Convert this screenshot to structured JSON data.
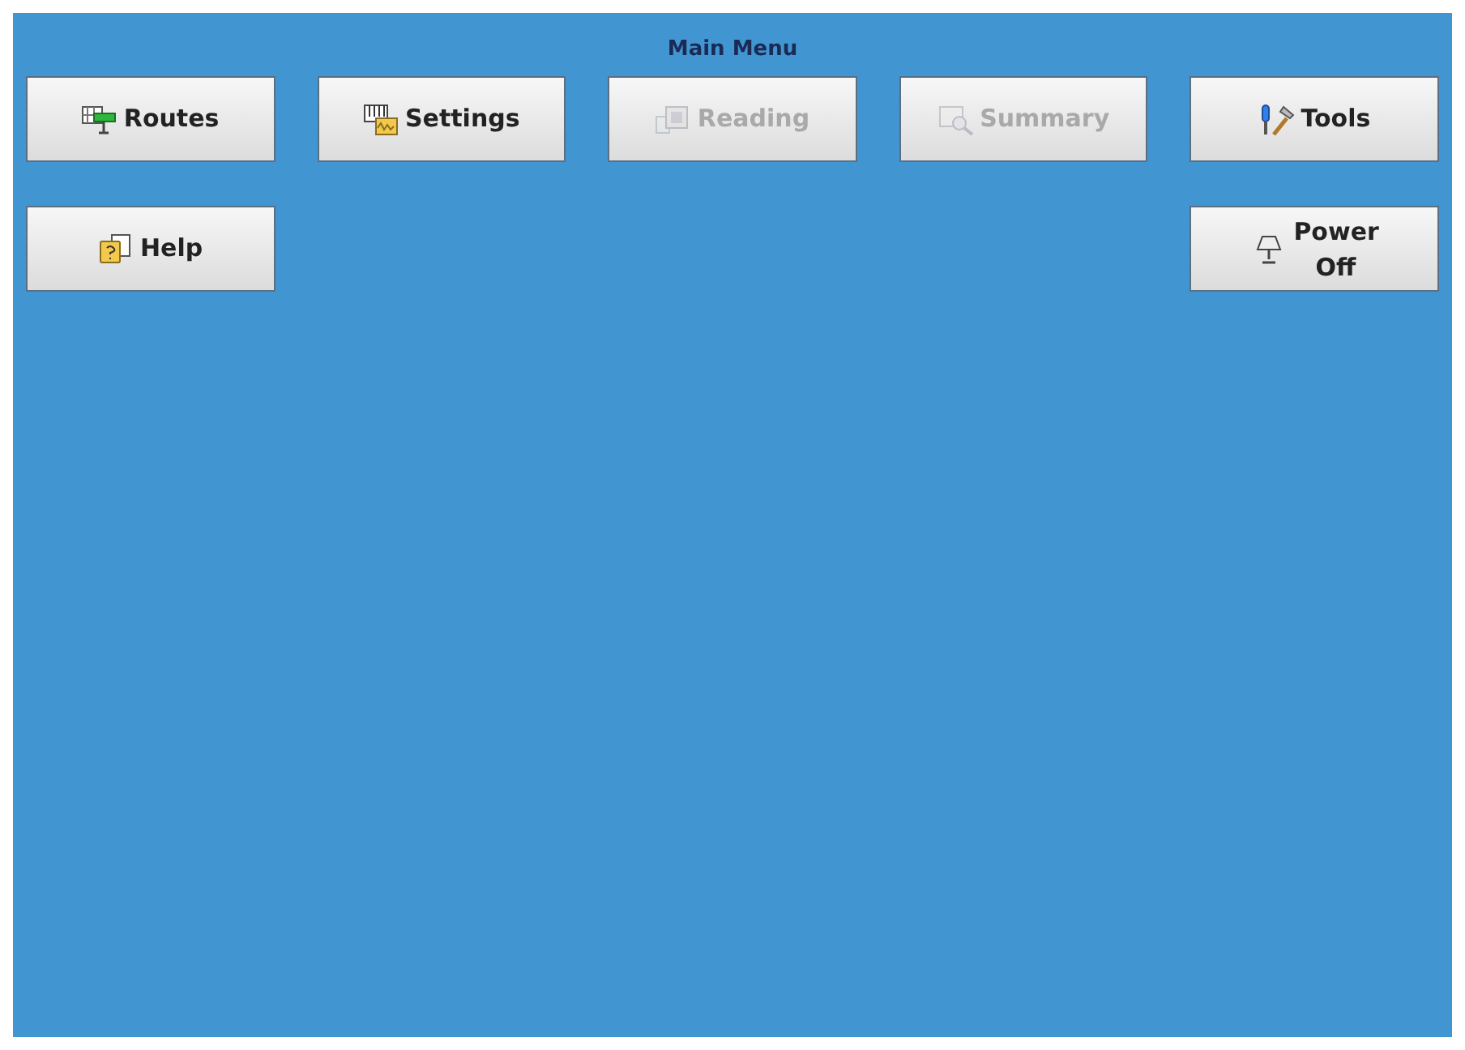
{
  "title": "Main Menu",
  "top_buttons": [
    {
      "label": "Routes",
      "disabled": false
    },
    {
      "label": "Settings",
      "disabled": false
    },
    {
      "label": "Reading",
      "disabled": true
    },
    {
      "label": "Summary",
      "disabled": true
    },
    {
      "label": "Tools",
      "disabled": false
    }
  ],
  "left_buttons": [
    {
      "label": "Help",
      "disabled": false
    }
  ],
  "right_buttons": [
    {
      "label": "Power Off",
      "disabled": false
    }
  ]
}
